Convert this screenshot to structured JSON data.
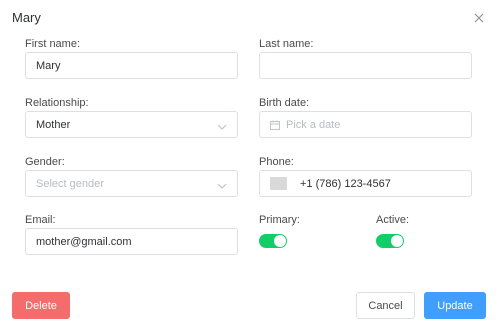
{
  "dialog": {
    "title": "Mary"
  },
  "form": {
    "first_name": {
      "label": "First name:",
      "value": "Mary"
    },
    "last_name": {
      "label": "Last name:",
      "value": ""
    },
    "relationship": {
      "label": "Relationship:",
      "value": "Mother"
    },
    "birth_date": {
      "label": "Birth date:",
      "placeholder": "Pick a date"
    },
    "gender": {
      "label": "Gender:",
      "placeholder": "Select gender"
    },
    "phone": {
      "label": "Phone:",
      "value": "+1 (786) 123-4567"
    },
    "email": {
      "label": "Email:",
      "value": "mother@gmail.com"
    },
    "primary": {
      "label": "Primary:",
      "on": true
    },
    "active": {
      "label": "Active:",
      "on": true
    }
  },
  "buttons": {
    "delete": "Delete",
    "cancel": "Cancel",
    "update": "Update"
  },
  "colors": {
    "toggle_on": "#13ce66",
    "danger": "#f56c6c",
    "primary": "#409eff"
  },
  "icons": [
    "close-icon",
    "chevron-down-icon",
    "calendar-icon",
    "flag-icon"
  ]
}
